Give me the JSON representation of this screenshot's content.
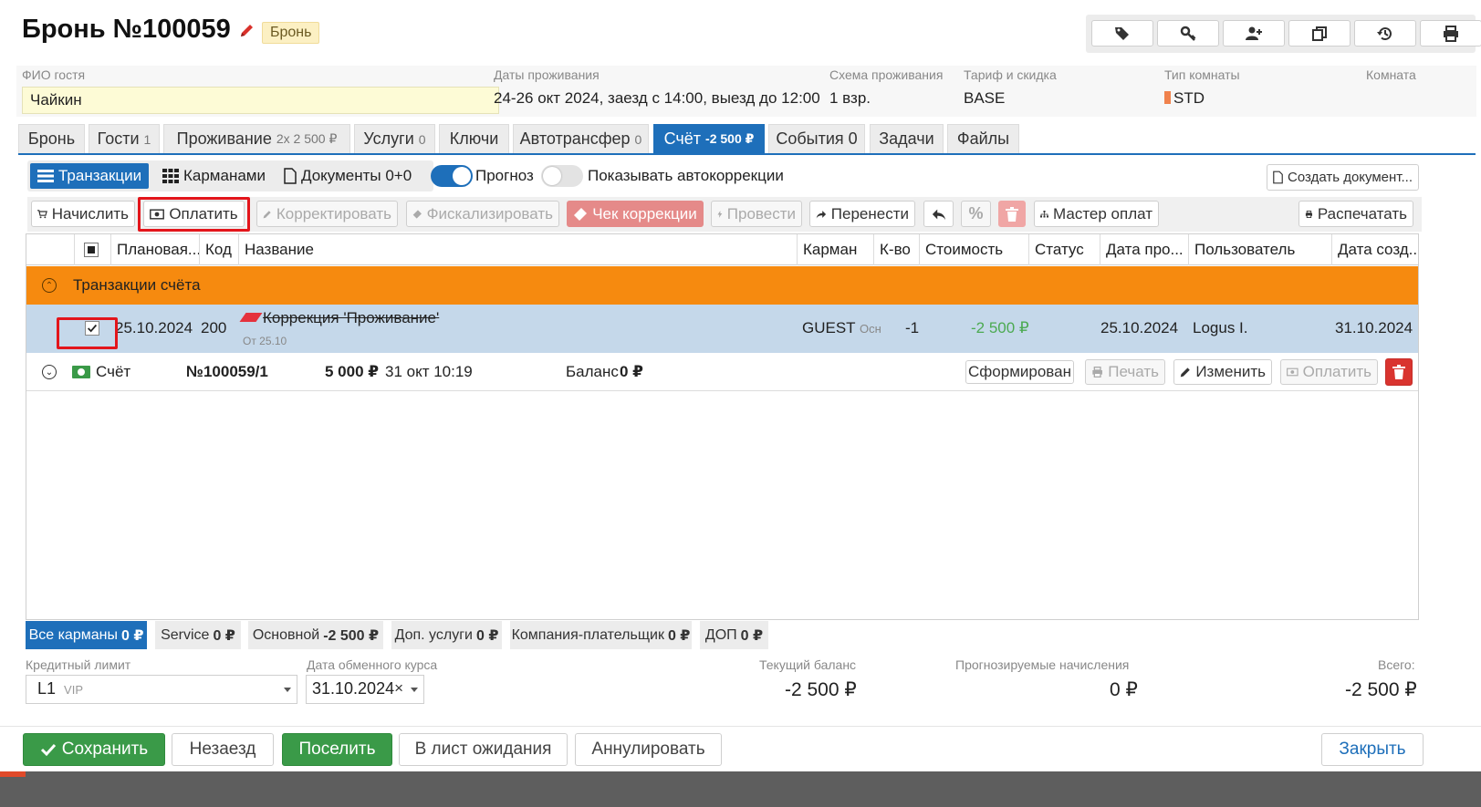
{
  "header": {
    "title": "Бронь №100059",
    "status_badge": "Бронь"
  },
  "info": {
    "guest_label": "ФИО гостя",
    "guest_value": "Чайкин",
    "dates_label": "Даты проживания",
    "dates_value": "24-26 окт 2024, заезд с 14:00, выезд до 12:00",
    "scheme_label": "Схема проживания",
    "scheme_value": "1 взр.",
    "tariff_label": "Тариф и скидка",
    "tariff_value": "BASE",
    "room_type_label": "Тип комнаты",
    "room_type_value": "STD",
    "room_label": "Комната"
  },
  "tabs": [
    {
      "label": "Бронь",
      "count": ""
    },
    {
      "label": "Гости",
      "count": "1"
    },
    {
      "label": "Проживание",
      "count": "2x 2 500 ₽"
    },
    {
      "label": "Услуги",
      "count": "0"
    },
    {
      "label": "Ключи",
      "count": ""
    },
    {
      "label": "Автотрансфер",
      "count": "0"
    },
    {
      "label": "Счёт",
      "count": "-2 500 ₽"
    },
    {
      "label": "События",
      "count": "0"
    },
    {
      "label": "Задачи",
      "count": ""
    },
    {
      "label": "Файлы",
      "count": ""
    }
  ],
  "subtabs": {
    "transactions": "Транзакции",
    "pockets": "Карманами",
    "documents": "Документы 0+0",
    "forecast": "Прогноз",
    "autocorrections": "Показывать автокоррекции",
    "create_document": "Создать документ..."
  },
  "actions": {
    "charge": "Начислить",
    "pay": "Оплатить",
    "correct": "Корректировать",
    "fiscalize": "Фискализировать",
    "correction_check": "Чек коррекции",
    "post": "Провести",
    "transfer": "Перенести",
    "payment_wizard": "Мастер оплат",
    "print": "Распечатать"
  },
  "grid": {
    "columns": [
      "Плановая...",
      "Код",
      "Название",
      "Карман",
      "К-во",
      "Стоимость",
      "Статус",
      "Дата про...",
      "Пользователь",
      "Дата созд..."
    ],
    "group_label": "Транзакции счёта",
    "row": {
      "planned_date": "25.10.2024",
      "code": "200",
      "name": "Коррекция 'Проживание'",
      "sub": "От 25.10",
      "pocket": "GUEST",
      "pocket_sub": "Осн",
      "qty": "-1",
      "cost": "-2 500 ₽",
      "posted_date": "25.10.2024",
      "user": "Logus I.",
      "created_date": "31.10.2024"
    },
    "invoice": {
      "label": "Счёт",
      "number": "№100059/1",
      "amount": "5 000 ₽",
      "date": "31 окт 10:19",
      "balance_label": "Баланс",
      "balance_value": "0 ₽",
      "status": "Сформирован",
      "print": "Печать",
      "edit": "Изменить",
      "pay": "Оплатить"
    }
  },
  "pocket_tabs": [
    {
      "label": "Все карманы",
      "value": "0 ₽"
    },
    {
      "label": "Service",
      "value": "0 ₽"
    },
    {
      "label": "Основной",
      "value": "-2 500 ₽"
    },
    {
      "label": "Доп. услуги",
      "value": "0 ₽"
    },
    {
      "label": "Компания-плательщик",
      "value": "0 ₽"
    },
    {
      "label": "ДОП",
      "value": "0 ₽"
    }
  ],
  "summary": {
    "credit_limit_label": "Кредитный лимит",
    "credit_limit_value": "L1",
    "credit_limit_sub": "VIP",
    "exchange_date_label": "Дата обменного курса",
    "exchange_date_value": "31.10.2024",
    "current_balance_label": "Текущий баланс",
    "current_balance_value": "-2 500 ₽",
    "forecast_label": "Прогнозируемые начисления",
    "forecast_value": "0 ₽",
    "total_label": "Всего:",
    "total_value": "-2 500 ₽"
  },
  "bottom": {
    "save": "Сохранить",
    "no_show": "Незаезд",
    "check_in": "Поселить",
    "waitlist": "В лист ожидания",
    "cancel": "Аннулировать",
    "close": "Закрыть"
  },
  "colors": {
    "accent": "#1e6fba",
    "group_row": "#f68a0f",
    "selected_row": "#c5d8ea",
    "green": "#3a9a48",
    "danger": "#d9342f"
  }
}
